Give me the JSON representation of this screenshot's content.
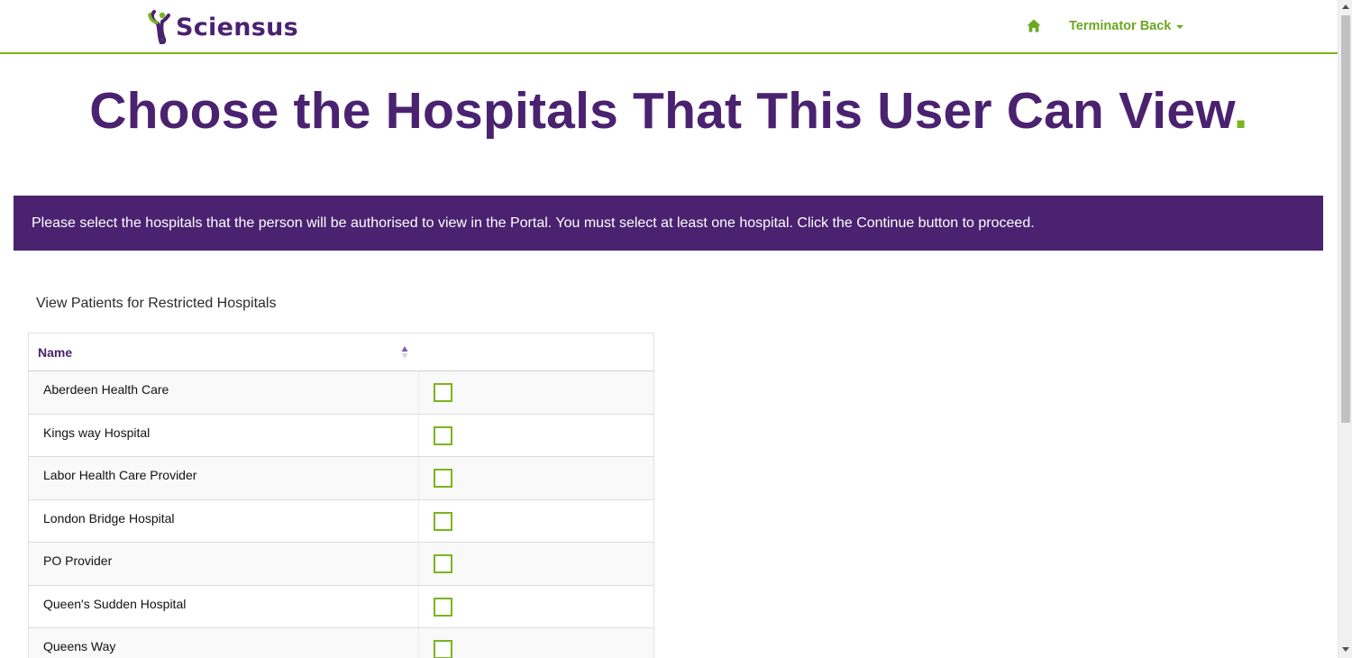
{
  "brand": {
    "name": "Sciensus",
    "primary_color": "#4a2270",
    "accent_color": "#7ab51d"
  },
  "navbar": {
    "home_icon": "home-icon",
    "user_menu_label": "Terminator Back",
    "user_menu_icon": "caret-down-icon"
  },
  "page": {
    "title": "Choose the Hospitals That This User Can View",
    "title_dot": "."
  },
  "banner": {
    "text": "Please select the hospitals that the person will be authorised to view in the Portal. You must select at least one hospital. Click the Continue button to proceed."
  },
  "section": {
    "label": "View Patients for Restricted Hospitals"
  },
  "table": {
    "columns": [
      "Name",
      ""
    ],
    "sort_icon": "sort-asc-icon",
    "rows": [
      {
        "name": "Aberdeen Health Care",
        "checked": false
      },
      {
        "name": "Kings way Hospital",
        "checked": false
      },
      {
        "name": "Labor Health Care Provider",
        "checked": false
      },
      {
        "name": "London Bridge Hospital",
        "checked": false
      },
      {
        "name": "PO Provider",
        "checked": false
      },
      {
        "name": "Queen's Sudden Hospital",
        "checked": false
      },
      {
        "name": "Queens Way",
        "checked": false
      }
    ]
  }
}
